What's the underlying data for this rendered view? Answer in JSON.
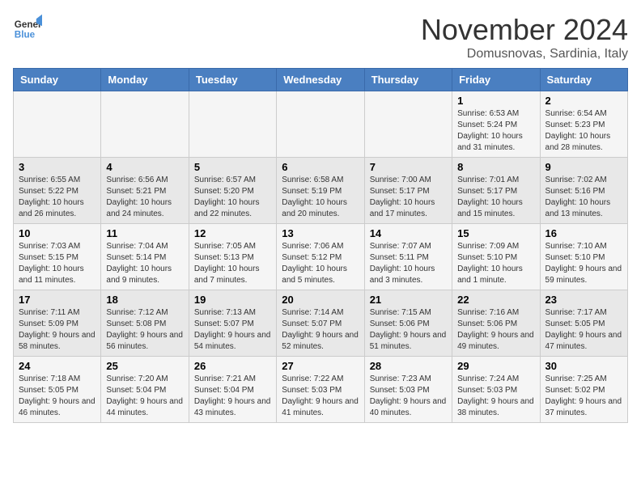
{
  "logo": {
    "text_general": "General",
    "text_blue": "Blue"
  },
  "header": {
    "month": "November 2024",
    "location": "Domusnovas, Sardinia, Italy"
  },
  "weekdays": [
    "Sunday",
    "Monday",
    "Tuesday",
    "Wednesday",
    "Thursday",
    "Friday",
    "Saturday"
  ],
  "weeks": [
    [
      {
        "day": "",
        "info": ""
      },
      {
        "day": "",
        "info": ""
      },
      {
        "day": "",
        "info": ""
      },
      {
        "day": "",
        "info": ""
      },
      {
        "day": "",
        "info": ""
      },
      {
        "day": "1",
        "info": "Sunrise: 6:53 AM\nSunset: 5:24 PM\nDaylight: 10 hours and 31 minutes."
      },
      {
        "day": "2",
        "info": "Sunrise: 6:54 AM\nSunset: 5:23 PM\nDaylight: 10 hours and 28 minutes."
      }
    ],
    [
      {
        "day": "3",
        "info": "Sunrise: 6:55 AM\nSunset: 5:22 PM\nDaylight: 10 hours and 26 minutes."
      },
      {
        "day": "4",
        "info": "Sunrise: 6:56 AM\nSunset: 5:21 PM\nDaylight: 10 hours and 24 minutes."
      },
      {
        "day": "5",
        "info": "Sunrise: 6:57 AM\nSunset: 5:20 PM\nDaylight: 10 hours and 22 minutes."
      },
      {
        "day": "6",
        "info": "Sunrise: 6:58 AM\nSunset: 5:19 PM\nDaylight: 10 hours and 20 minutes."
      },
      {
        "day": "7",
        "info": "Sunrise: 7:00 AM\nSunset: 5:17 PM\nDaylight: 10 hours and 17 minutes."
      },
      {
        "day": "8",
        "info": "Sunrise: 7:01 AM\nSunset: 5:17 PM\nDaylight: 10 hours and 15 minutes."
      },
      {
        "day": "9",
        "info": "Sunrise: 7:02 AM\nSunset: 5:16 PM\nDaylight: 10 hours and 13 minutes."
      }
    ],
    [
      {
        "day": "10",
        "info": "Sunrise: 7:03 AM\nSunset: 5:15 PM\nDaylight: 10 hours and 11 minutes."
      },
      {
        "day": "11",
        "info": "Sunrise: 7:04 AM\nSunset: 5:14 PM\nDaylight: 10 hours and 9 minutes."
      },
      {
        "day": "12",
        "info": "Sunrise: 7:05 AM\nSunset: 5:13 PM\nDaylight: 10 hours and 7 minutes."
      },
      {
        "day": "13",
        "info": "Sunrise: 7:06 AM\nSunset: 5:12 PM\nDaylight: 10 hours and 5 minutes."
      },
      {
        "day": "14",
        "info": "Sunrise: 7:07 AM\nSunset: 5:11 PM\nDaylight: 10 hours and 3 minutes."
      },
      {
        "day": "15",
        "info": "Sunrise: 7:09 AM\nSunset: 5:10 PM\nDaylight: 10 hours and 1 minute."
      },
      {
        "day": "16",
        "info": "Sunrise: 7:10 AM\nSunset: 5:10 PM\nDaylight: 9 hours and 59 minutes."
      }
    ],
    [
      {
        "day": "17",
        "info": "Sunrise: 7:11 AM\nSunset: 5:09 PM\nDaylight: 9 hours and 58 minutes."
      },
      {
        "day": "18",
        "info": "Sunrise: 7:12 AM\nSunset: 5:08 PM\nDaylight: 9 hours and 56 minutes."
      },
      {
        "day": "19",
        "info": "Sunrise: 7:13 AM\nSunset: 5:07 PM\nDaylight: 9 hours and 54 minutes."
      },
      {
        "day": "20",
        "info": "Sunrise: 7:14 AM\nSunset: 5:07 PM\nDaylight: 9 hours and 52 minutes."
      },
      {
        "day": "21",
        "info": "Sunrise: 7:15 AM\nSunset: 5:06 PM\nDaylight: 9 hours and 51 minutes."
      },
      {
        "day": "22",
        "info": "Sunrise: 7:16 AM\nSunset: 5:06 PM\nDaylight: 9 hours and 49 minutes."
      },
      {
        "day": "23",
        "info": "Sunrise: 7:17 AM\nSunset: 5:05 PM\nDaylight: 9 hours and 47 minutes."
      }
    ],
    [
      {
        "day": "24",
        "info": "Sunrise: 7:18 AM\nSunset: 5:05 PM\nDaylight: 9 hours and 46 minutes."
      },
      {
        "day": "25",
        "info": "Sunrise: 7:20 AM\nSunset: 5:04 PM\nDaylight: 9 hours and 44 minutes."
      },
      {
        "day": "26",
        "info": "Sunrise: 7:21 AM\nSunset: 5:04 PM\nDaylight: 9 hours and 43 minutes."
      },
      {
        "day": "27",
        "info": "Sunrise: 7:22 AM\nSunset: 5:03 PM\nDaylight: 9 hours and 41 minutes."
      },
      {
        "day": "28",
        "info": "Sunrise: 7:23 AM\nSunset: 5:03 PM\nDaylight: 9 hours and 40 minutes."
      },
      {
        "day": "29",
        "info": "Sunrise: 7:24 AM\nSunset: 5:03 PM\nDaylight: 9 hours and 38 minutes."
      },
      {
        "day": "30",
        "info": "Sunrise: 7:25 AM\nSunset: 5:02 PM\nDaylight: 9 hours and 37 minutes."
      }
    ]
  ]
}
